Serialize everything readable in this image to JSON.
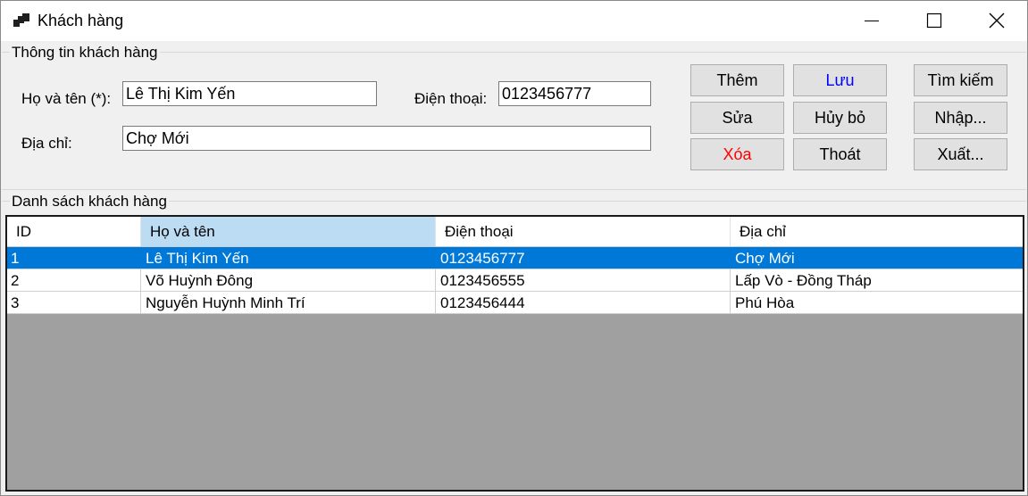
{
  "window": {
    "title": "Khách hàng",
    "icon": "app-window-icon",
    "controls": [
      "minimize-icon",
      "maximize-icon",
      "close-icon"
    ]
  },
  "info_group": {
    "label": "Thông tin khách hàng",
    "name_label": "Họ và tên (*):",
    "name_value": "Lê Thị Kim Yến",
    "phone_label": "Điện thoại:",
    "phone_value": "0123456777",
    "address_label": "Địa chỉ:",
    "address_value": "Chợ Mới"
  },
  "buttons": {
    "add": "Thêm",
    "save": "Lưu",
    "search": "Tìm kiếm",
    "edit": "Sửa",
    "cancel": "Hủy bỏ",
    "import": "Nhập...",
    "delete": "Xóa",
    "exit": "Thoát",
    "export": "Xuất..."
  },
  "colors": {
    "save_text": "#0000ff",
    "delete_text": "#ff0000",
    "selection": "#0078d7",
    "header_selected": "#bcdcf4"
  },
  "list_group": {
    "label": "Danh sách khách hàng",
    "columns": [
      "ID",
      "Họ và tên",
      "Điện thoại",
      "Địa chỉ"
    ],
    "rows": [
      {
        "id": "1",
        "name": "Lê Thị Kim Yến",
        "phone": "0123456777",
        "address": "Chợ Mới"
      },
      {
        "id": "2",
        "name": "Võ Huỳnh Đông",
        "phone": "0123456555",
        "address": "Lấp Vò - Đồng Tháp"
      },
      {
        "id": "3",
        "name": "Nguyễn Huỳnh Minh Trí",
        "phone": "0123456444",
        "address": "Phú Hòa"
      }
    ]
  }
}
